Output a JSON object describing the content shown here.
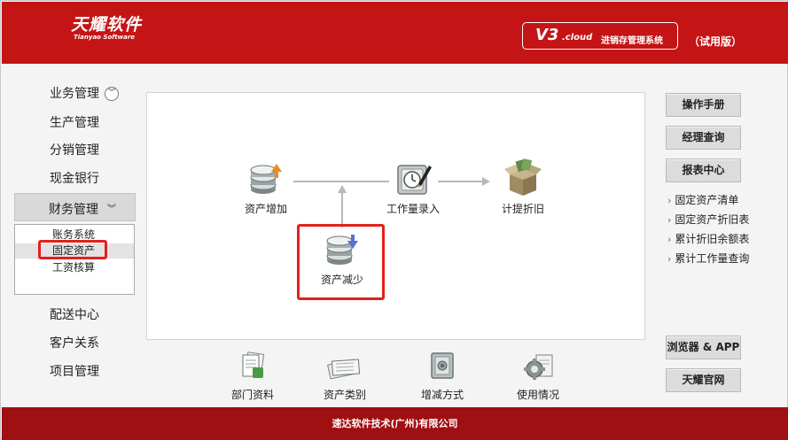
{
  "header": {
    "logo_cn": "天耀软件",
    "logo_en": "Tianyao Software",
    "product_version": "V3",
    "product_cloud": ".cloud",
    "product_name": "进销存管理系统",
    "trial": "（试用版）"
  },
  "sidebar": {
    "items": [
      {
        "label": "业务管理"
      },
      {
        "label": "生产管理"
      },
      {
        "label": "分销管理"
      },
      {
        "label": "现金银行"
      },
      {
        "label": "财务管理"
      },
      {
        "label": "配送中心"
      },
      {
        "label": "客户关系"
      },
      {
        "label": "项目管理"
      }
    ],
    "collapse_glyph": "︾",
    "expand_glyph": "︾",
    "finance_submenu": [
      {
        "label": "账务系统"
      },
      {
        "label": "固定资产"
      },
      {
        "label": "工资核算"
      }
    ]
  },
  "flow": {
    "asset_add": "资产增加",
    "workload_entry": "工作量录入",
    "depreciation": "计提折旧",
    "asset_reduce": "资产减少"
  },
  "shortcuts": [
    {
      "label": "部门资料"
    },
    {
      "label": "资产类别"
    },
    {
      "label": "增减方式"
    },
    {
      "label": "使用情况"
    }
  ],
  "right": {
    "manual": "操作手册",
    "manager_query": "经理查询",
    "report_center": "报表中心",
    "reports": [
      {
        "label": "固定资产清单"
      },
      {
        "label": "固定资产折旧表"
      },
      {
        "label": "累计折旧余额表"
      },
      {
        "label": "累计工作量查询"
      }
    ],
    "browser_app": "浏览器 & APP",
    "official_site": "天耀官网"
  },
  "footer": {
    "company": "速达软件技术(广州)有限公司"
  },
  "colors": {
    "brand_red": "#c41416",
    "footer_red": "#a00f12",
    "highlight_red": "#e3201b"
  }
}
